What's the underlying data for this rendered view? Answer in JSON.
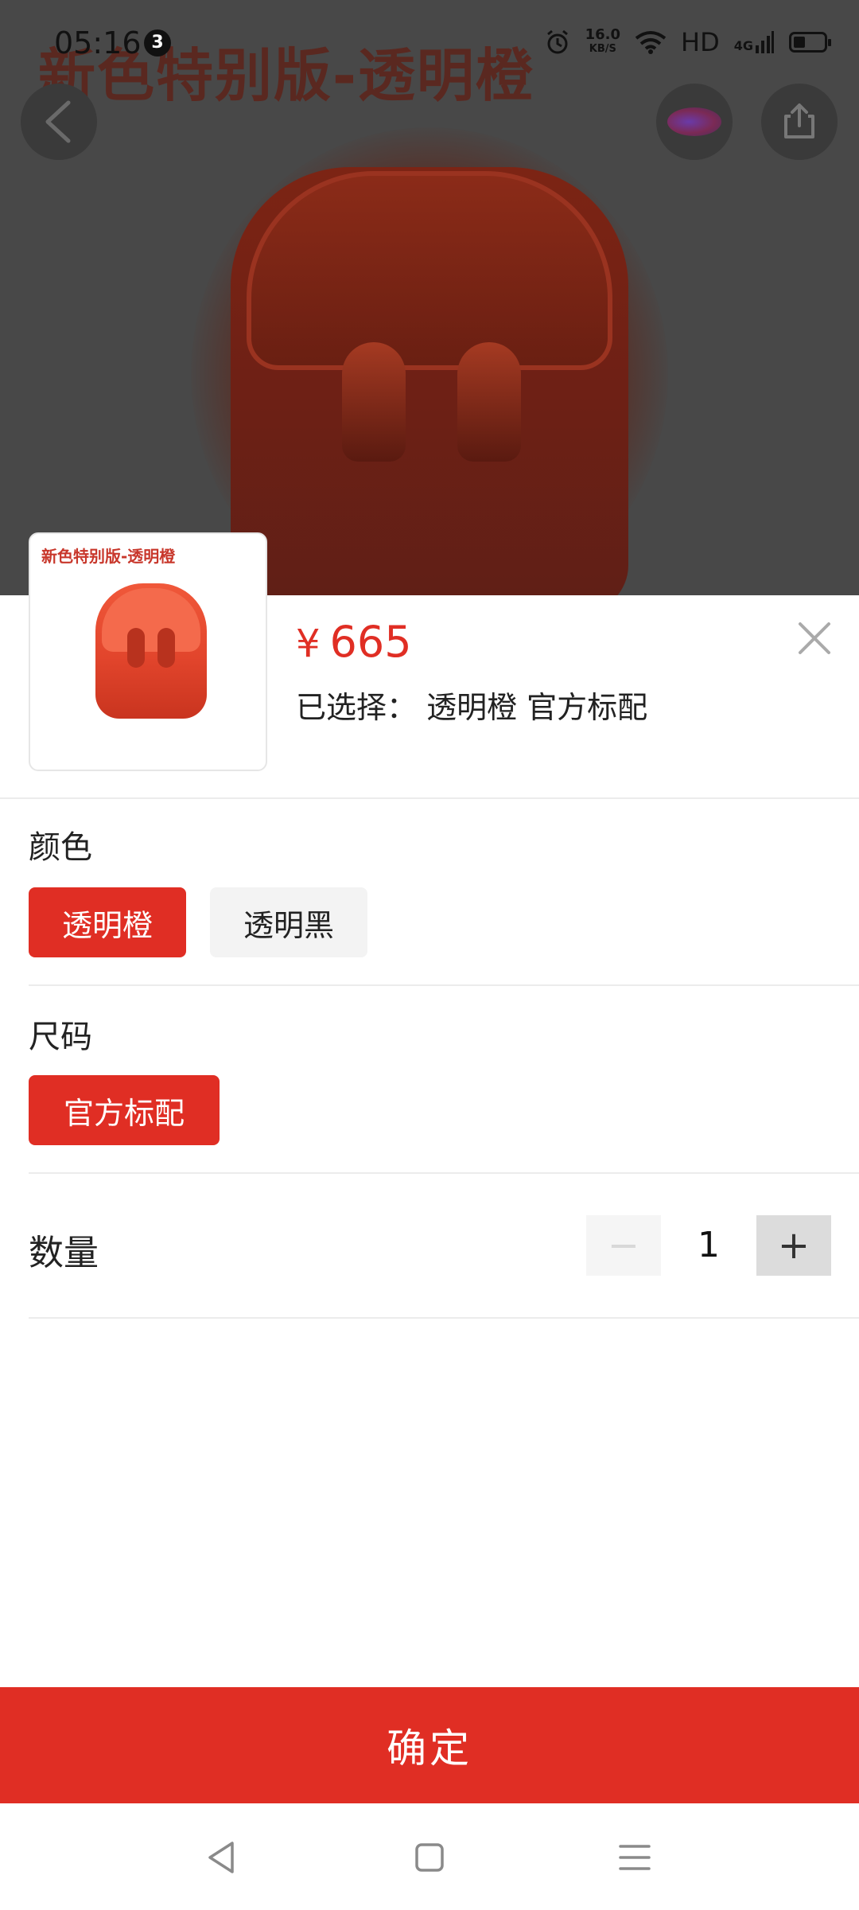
{
  "status_bar": {
    "time": "05:16",
    "notification_count": "3",
    "net_speed_value": "16.0",
    "net_speed_unit": "KB/S",
    "hd_label": "HD",
    "network_label": "4G"
  },
  "backdrop": {
    "hero_title": "新色特别版-透明橙"
  },
  "sheet": {
    "thumbnail_caption": "新色特别版-透明橙",
    "currency_symbol": "¥",
    "price": "665",
    "selected_text": "已选择： 透明橙 官方标配"
  },
  "color_section": {
    "title": "颜色",
    "options": [
      {
        "label": "透明橙",
        "selected": true
      },
      {
        "label": "透明黑",
        "selected": false
      }
    ]
  },
  "size_section": {
    "title": "尺码",
    "options": [
      {
        "label": "官方标配",
        "selected": true
      }
    ]
  },
  "quantity": {
    "label": "数量",
    "minus_symbol": "−",
    "value": "1",
    "plus_symbol": "+"
  },
  "confirm_label": "确定",
  "colors": {
    "accent": "#e02e24",
    "chip_idle": "#f3f3f3",
    "overlay": "#484848"
  },
  "icons": {
    "back": "back-arrow-icon",
    "brand": "brand-logo-icon",
    "share": "share-icon",
    "close": "close-icon",
    "nav_back": "nav-back-icon",
    "nav_home": "nav-home-icon",
    "nav_menu": "nav-menu-icon"
  }
}
